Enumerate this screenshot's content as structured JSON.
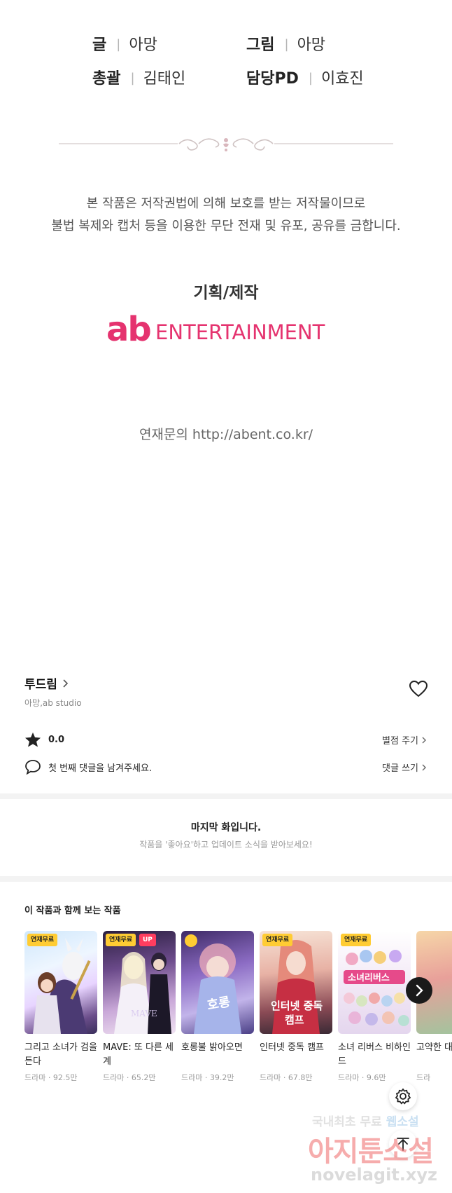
{
  "credits": {
    "writer_role": "글",
    "writer_name": "아망",
    "artist_role": "그림",
    "artist_name": "아망",
    "director_role": "총괄",
    "director_name": "김태인",
    "pd_role": "담당PD",
    "pd_name": "이효진",
    "separator": "|"
  },
  "notice": {
    "line1": "본 작품은 저작권법에 의해 보호를 받는 저작물이므로",
    "line2": "불법 복제와 캡처 등을 이용한 무단 전재 및 유포, 공유를 금합니다."
  },
  "production": {
    "label": "기획/제작",
    "logo_ab": "ab",
    "logo_text": "ENTERTAINMENT",
    "serial": "연재문의 http://abent.co.kr/"
  },
  "work": {
    "title": "투드림",
    "authors": "아망,ab studio",
    "rating": "0.0",
    "rate_label": "별점 주기",
    "comment_prompt": "첫 번째 댓글을 남겨주세요.",
    "comment_label": "댓글 쓰기"
  },
  "last_episode": {
    "title": "마지막 화입니다.",
    "subtitle": "작품을 '좋아요'하고 업데이트 소식을 받아보세요!"
  },
  "recommendations": {
    "heading": "이 작품과 함께 보는 작품",
    "items": [
      {
        "title": "그리고 소녀가 검을 든다",
        "meta": "드라마 · 92.5만",
        "badge": "연재무료",
        "up": ""
      },
      {
        "title": "MAVE: 또 다른 세계",
        "meta": "드라마 · 65.2만",
        "badge": "연재무료",
        "up": "UP"
      },
      {
        "title": "호롱불 밝아오면",
        "meta": "드라마 · 39.2만",
        "badge": "",
        "up": ""
      },
      {
        "title": "인터넷 중독 캠프",
        "meta": "드라마 · 67.8만",
        "badge": "연재무료",
        "up": ""
      },
      {
        "title": "소녀 리버스 비하인드",
        "meta": "드라마 · 9.6만",
        "badge": "연재무료",
        "up": ""
      },
      {
        "title": "고약한 대",
        "meta": "드라",
        "badge": "",
        "up": ""
      }
    ]
  },
  "watermark": {
    "line1_a": "국내최초 무료",
    "line1_b": "웹소설",
    "line2": "아지툰소설",
    "line3": "novelagit.xyz"
  },
  "colors": {
    "brand_pink": "#e5336f",
    "badge_yellow": "#ffcc33",
    "badge_red": "#ff3d5f",
    "panel_gray": "#f3f3f3"
  }
}
